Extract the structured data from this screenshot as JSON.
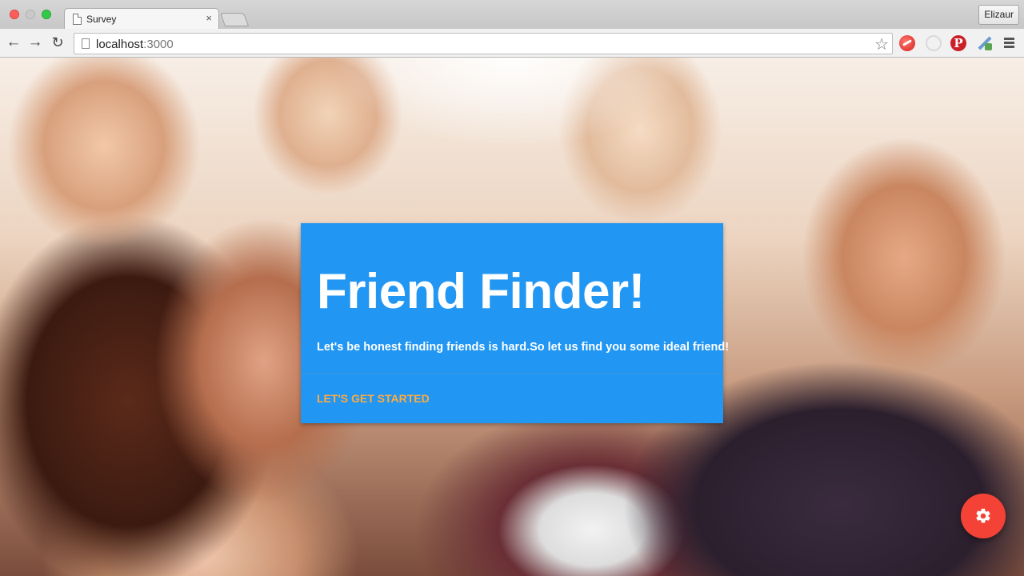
{
  "browser": {
    "tab_title": "Survey",
    "tab_close": "×",
    "profile_name": "Elizaur",
    "url_host": "localhost",
    "url_port": ":3000",
    "icons": {
      "back": "←",
      "forward": "→",
      "reload": "↻",
      "bookmark_star": "☆",
      "pinterest": "P"
    }
  },
  "card": {
    "title": "Friend Finder!",
    "text": "Let's be honest finding friends is hard.So let us find you some ideal friend!",
    "action_label": "LET'S GET STARTED"
  },
  "fab": {
    "icon": "gear-icon"
  },
  "colors": {
    "card_background": "#2196f3",
    "action_text": "#ffab40",
    "fab_background": "#f44336"
  }
}
